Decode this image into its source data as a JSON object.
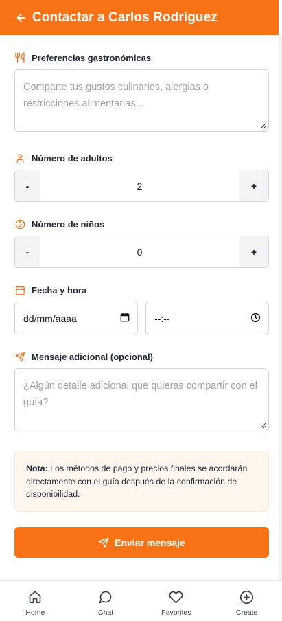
{
  "header": {
    "title": "Contactar a Carlos Rodríguez",
    "back_icon": "arrow-left-icon"
  },
  "form": {
    "preferences": {
      "label": "Preferencias gastronómicas",
      "icon": "utensils-icon",
      "placeholder": "Comparte tus gustos culinarios, alergias o restricciones alimentarias..."
    },
    "adults": {
      "label": "Número de adultos",
      "icon": "user-icon",
      "minus": "-",
      "value": "2",
      "plus": "+"
    },
    "children": {
      "label": "Número de niños",
      "icon": "baby-icon",
      "minus": "-",
      "value": "0",
      "plus": "+"
    },
    "datetime": {
      "label": "Fecha y hora",
      "icon": "calendar-icon",
      "date_placeholder": "dd/mm/aaaa",
      "time_placeholder": "--:--"
    },
    "message": {
      "label": "Mensaje adicional (opcional)",
      "icon": "send-icon",
      "placeholder": "¿Algún detalle adicional que quieras compartir con el guía?"
    },
    "note": {
      "bold": "Nota:",
      "text": " Los métodos de pago y precios finales se acordarán directamente con el guía después de la confirmación de disponibilidad."
    },
    "submit_label": "Enviar mensaje"
  },
  "nav": {
    "items": [
      {
        "label": "Home",
        "icon": "home-icon"
      },
      {
        "label": "Chat",
        "icon": "chat-icon"
      },
      {
        "label": "Favorites",
        "icon": "heart-icon"
      },
      {
        "label": "Create",
        "icon": "plus-circle-icon"
      }
    ]
  },
  "colors": {
    "accent": "#f97316",
    "note_bg": "#fff7ed"
  }
}
